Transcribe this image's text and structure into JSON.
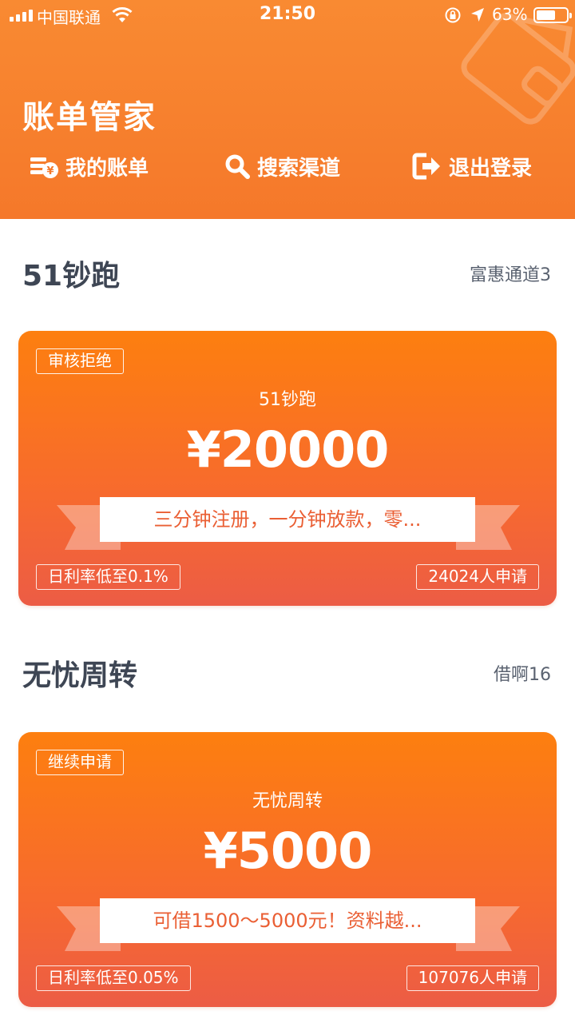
{
  "status_bar": {
    "carrier": "中国联通",
    "time": "21:50",
    "battery_percent": "63%",
    "battery_level": 0.63,
    "icons": [
      "signal-icon",
      "wifi-icon",
      "rotation-lock-icon",
      "location-icon",
      "battery-icon"
    ]
  },
  "header": {
    "title": "账单管家",
    "nav": [
      {
        "label": "我的账单",
        "icon": "bills-icon"
      },
      {
        "label": "搜索渠道",
        "icon": "search-icon"
      },
      {
        "label": "退出登录",
        "icon": "logout-icon"
      }
    ],
    "colors": {
      "primary": "#f5782a",
      "text": "#ffffff"
    }
  },
  "sections": [
    {
      "title": "51钞跑",
      "subtitle": "富惠通道3",
      "card": {
        "status": "审核拒绝",
        "name": "51钞跑",
        "amount": "¥20000",
        "slogan": "三分钟注册，一分钟放款，零...",
        "rate": "日利率低至0.1%",
        "applicants": "24024人申请"
      }
    },
    {
      "title": "无忧周转",
      "subtitle": "借啊16",
      "card": {
        "status": "继续申请",
        "name": "无忧周转",
        "amount": "¥5000",
        "slogan": "可借1500～5000元！资料越...",
        "rate": "日利率低至0.05%",
        "applicants": "107076人申请"
      }
    }
  ]
}
